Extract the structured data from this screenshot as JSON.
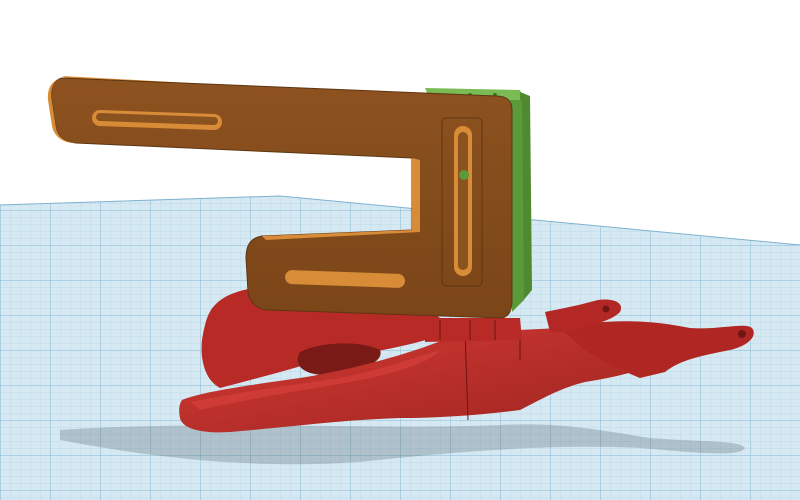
{
  "viewport": {
    "background_color": "#ffffff",
    "grid_color": "#cfe4f0",
    "grid_line_color": "#9fc6dc",
    "grid_major_line_color": "#7fb1cf"
  },
  "model": {
    "bracket": {
      "color": "#8b4f1f",
      "edge_color": "#d98c38",
      "icon": "bracket-icon"
    },
    "mount_block": {
      "color": "#5b9a3a",
      "edge_color": "#3e7327",
      "icon": "mount-block-icon"
    },
    "base_clamp": {
      "color": "#c0302c",
      "edge_color": "#8f1f1c",
      "icon": "base-clamp-icon"
    },
    "shadow_color": "#4a5a66"
  },
  "watermark": {
    "label": "",
    "color": "#ffffff"
  }
}
